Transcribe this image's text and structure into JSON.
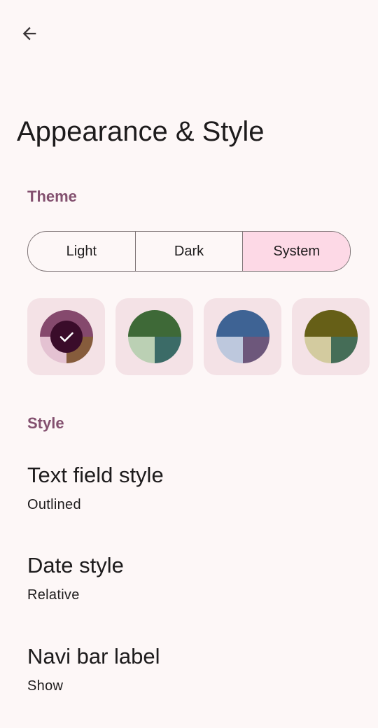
{
  "toolbar": {
    "back_icon": "arrow-back-icon"
  },
  "page": {
    "title": "Appearance & Style"
  },
  "theme": {
    "header": "Theme",
    "options": [
      "Light",
      "Dark",
      "System"
    ],
    "selected": "System"
  },
  "palettes": [
    {
      "name": "pink",
      "selected": true,
      "colors": {
        "top": "#85496d",
        "bottom_left": "#e4c2d2",
        "bottom_right": "#865c3c"
      },
      "check_icon": "check-icon"
    },
    {
      "name": "green",
      "selected": false,
      "colors": {
        "top": "#3e6937",
        "bottom_left": "#bbd0b4",
        "bottom_right": "#3b6b67"
      }
    },
    {
      "name": "blue",
      "selected": false,
      "colors": {
        "top": "#3e6394",
        "bottom_left": "#bdc8dd",
        "bottom_right": "#6d577b"
      }
    },
    {
      "name": "olive",
      "selected": false,
      "colors": {
        "top": "#665f17",
        "bottom_left": "#d3cb9f",
        "bottom_right": "#456d57"
      }
    }
  ],
  "style": {
    "header": "Style",
    "items": [
      {
        "title": "Text field style",
        "value": "Outlined"
      },
      {
        "title": "Date style",
        "value": "Relative"
      },
      {
        "title": "Navi bar label",
        "value": "Show"
      }
    ]
  },
  "colors": {
    "background": "#fdf7f7",
    "accent": "#83506f",
    "segment_selected": "#fdd9e6",
    "swatch_card": "#f4e2e6",
    "check_badge": "#3a0c2a"
  }
}
